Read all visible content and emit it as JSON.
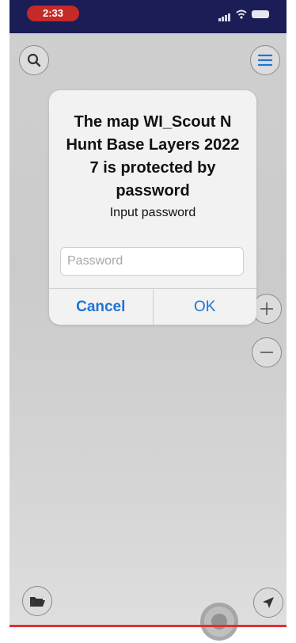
{
  "status_bar": {
    "time": "2:33"
  },
  "dialog": {
    "title": "The map WI_Scout N Hunt Base Layers 2022 7 is protected by password",
    "message": "Input password",
    "password_placeholder": "Password",
    "cancel_label": "Cancel",
    "ok_label": "OK"
  },
  "map_controls": {
    "icons": [
      "search-icon",
      "menu-icon",
      "zoom-in-icon",
      "zoom-out-icon",
      "folder-icon",
      "locate-arrow-icon"
    ]
  },
  "colors": {
    "status_bar_bg": "#1b1d57",
    "time_pill": "#c32a28",
    "accent_blue": "#1f74d3",
    "map_bg": "#cfcfcf"
  }
}
